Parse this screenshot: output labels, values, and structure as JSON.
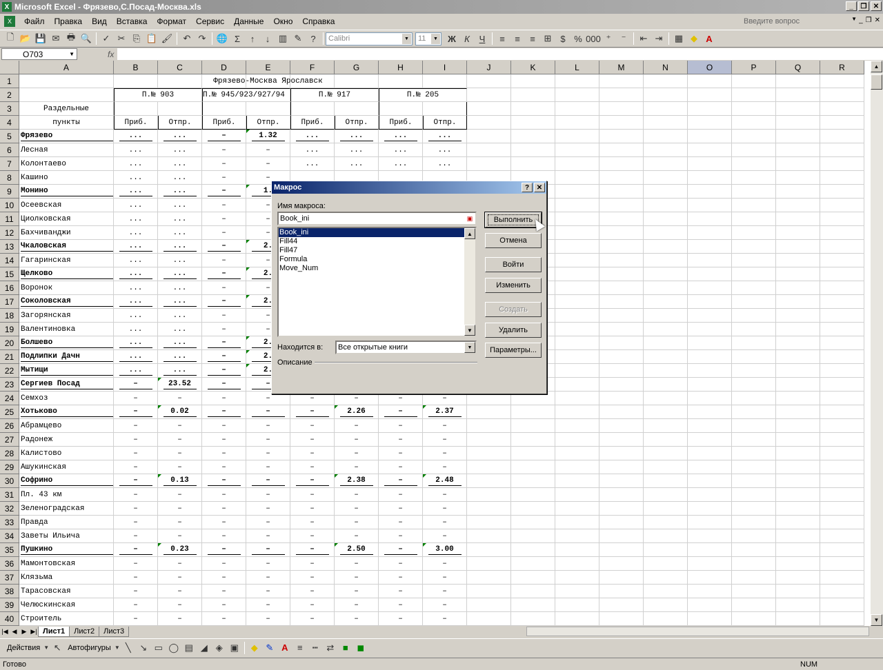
{
  "app": {
    "title": "Microsoft Excel - Фрязево,С.Посад-Москва.xls",
    "ask_placeholder": "Введите вопрос",
    "menu": [
      "Файл",
      "Правка",
      "Вид",
      "Вставка",
      "Формат",
      "Сервис",
      "Данные",
      "Окно",
      "Справка"
    ]
  },
  "toolbar": {
    "font": "Calibri",
    "size": "11"
  },
  "formula_bar": {
    "name_box": "O703",
    "fx": "fx",
    "value": ""
  },
  "columns": [
    {
      "label": "A"
    },
    {
      "label": "B"
    },
    {
      "label": "C"
    },
    {
      "label": "D"
    },
    {
      "label": "E"
    },
    {
      "label": "F"
    },
    {
      "label": "G"
    },
    {
      "label": "H"
    },
    {
      "label": "I"
    },
    {
      "label": "J"
    },
    {
      "label": "K"
    },
    {
      "label": "L"
    },
    {
      "label": "M"
    },
    {
      "label": "N"
    },
    {
      "label": "O",
      "selected": true
    },
    {
      "label": "P"
    },
    {
      "label": "Q"
    },
    {
      "label": "R"
    }
  ],
  "header": {
    "title": "Фрязево-Москва Ярославск",
    "trains": [
      "П.№ 903",
      "П.№ 945/923/927/94",
      "П.№ 917",
      "П.№ 205"
    ],
    "label_top": "Раздельные",
    "label_bottom": "пункты",
    "arr": "Приб.",
    "dep": "Отпр."
  },
  "rows": [
    {
      "n": 5,
      "name": "Фрязево",
      "bold": true,
      "v": [
        "...",
        "...",
        "–",
        "1.32",
        "...",
        "...",
        "...",
        "..."
      ]
    },
    {
      "n": 6,
      "name": "Лесная",
      "bold": false,
      "v": [
        "...",
        "...",
        "–",
        "–",
        "...",
        "...",
        "...",
        "..."
      ]
    },
    {
      "n": 7,
      "name": "Колонтаево",
      "bold": false,
      "v": [
        "...",
        "...",
        "–",
        "–",
        "...",
        "...",
        "...",
        "..."
      ]
    },
    {
      "n": 8,
      "name": "Кашино",
      "bold": false,
      "v": [
        "...",
        "...",
        "–",
        "–",
        "",
        "",
        "",
        ""
      ]
    },
    {
      "n": 9,
      "name": "Монино",
      "bold": true,
      "v": [
        "...",
        "...",
        "–",
        "1.",
        "",
        "",
        "",
        ""
      ]
    },
    {
      "n": 10,
      "name": "Осеевская",
      "bold": false,
      "v": [
        "...",
        "...",
        "–",
        "–",
        "",
        "",
        "",
        ""
      ]
    },
    {
      "n": 11,
      "name": "Циолковская",
      "bold": false,
      "v": [
        "...",
        "...",
        "–",
        "–",
        "",
        "",
        "",
        ""
      ]
    },
    {
      "n": 12,
      "name": "Бахчиванджи",
      "bold": false,
      "v": [
        "...",
        "...",
        "–",
        "–",
        "",
        "",
        "",
        ""
      ]
    },
    {
      "n": 13,
      "name": "Чкаловская",
      "bold": true,
      "v": [
        "...",
        "...",
        "–",
        "2.",
        "",
        "",
        "",
        ""
      ]
    },
    {
      "n": 14,
      "name": "Гагаринская",
      "bold": false,
      "v": [
        "...",
        "...",
        "–",
        "–",
        "",
        "",
        "",
        ""
      ]
    },
    {
      "n": 15,
      "name": "Щелково",
      "bold": true,
      "v": [
        "...",
        "...",
        "–",
        "2.",
        "",
        "",
        "",
        ""
      ]
    },
    {
      "n": 16,
      "name": "Воронок",
      "bold": false,
      "v": [
        "...",
        "...",
        "–",
        "–",
        "",
        "",
        "",
        ""
      ]
    },
    {
      "n": 17,
      "name": "Соколовская",
      "bold": true,
      "v": [
        "...",
        "...",
        "–",
        "2.",
        "",
        "",
        "",
        ""
      ]
    },
    {
      "n": 18,
      "name": "Загорянская",
      "bold": false,
      "v": [
        "...",
        "...",
        "–",
        "–",
        "",
        "",
        "",
        ""
      ]
    },
    {
      "n": 19,
      "name": "Валентиновка",
      "bold": false,
      "v": [
        "...",
        "...",
        "–",
        "–",
        "",
        "",
        "",
        ""
      ]
    },
    {
      "n": 20,
      "name": "Болшево",
      "bold": true,
      "v": [
        "...",
        "...",
        "–",
        "2.",
        "",
        "",
        "",
        ""
      ]
    },
    {
      "n": 21,
      "name": "Подлипки Дачн",
      "bold": true,
      "v": [
        "...",
        "...",
        "–",
        "2.",
        "",
        "",
        "",
        ""
      ]
    },
    {
      "n": 22,
      "name": "Мытищи",
      "bold": true,
      "v": [
        "...",
        "...",
        "–",
        "2.",
        "",
        "",
        "",
        ""
      ]
    },
    {
      "n": 23,
      "name": "Сергиев Посад",
      "bold": true,
      "v": [
        "–",
        "23.52",
        "–",
        "–",
        "",
        "",
        "",
        ""
      ]
    },
    {
      "n": 24,
      "name": "Семхоз",
      "bold": false,
      "v": [
        "–",
        "–",
        "–",
        "–",
        "–",
        "–",
        "–",
        "–"
      ]
    },
    {
      "n": 25,
      "name": "Хотьково",
      "bold": true,
      "v": [
        "–",
        "0.02",
        "–",
        "–",
        "–",
        "2.26",
        "–",
        "2.37"
      ]
    },
    {
      "n": 26,
      "name": "Абрамцево",
      "bold": false,
      "v": [
        "–",
        "–",
        "–",
        "–",
        "–",
        "–",
        "–",
        "–"
      ]
    },
    {
      "n": 27,
      "name": "Радонеж",
      "bold": false,
      "v": [
        "–",
        "–",
        "–",
        "–",
        "–",
        "–",
        "–",
        "–"
      ]
    },
    {
      "n": 28,
      "name": "Калистово",
      "bold": false,
      "v": [
        "–",
        "–",
        "–",
        "–",
        "–",
        "–",
        "–",
        "–"
      ]
    },
    {
      "n": 29,
      "name": "Ашукинская",
      "bold": false,
      "v": [
        "–",
        "–",
        "–",
        "–",
        "–",
        "–",
        "–",
        "–"
      ]
    },
    {
      "n": 30,
      "name": "Софрино",
      "bold": true,
      "v": [
        "–",
        "0.13",
        "–",
        "–",
        "–",
        "2.38",
        "–",
        "2.48"
      ]
    },
    {
      "n": 31,
      "name": "Пл. 43 км",
      "bold": false,
      "v": [
        "–",
        "–",
        "–",
        "–",
        "–",
        "–",
        "–",
        "–"
      ]
    },
    {
      "n": 32,
      "name": "Зеленоградская",
      "bold": false,
      "v": [
        "–",
        "–",
        "–",
        "–",
        "–",
        "–",
        "–",
        "–"
      ]
    },
    {
      "n": 33,
      "name": "Правда",
      "bold": false,
      "v": [
        "–",
        "–",
        "–",
        "–",
        "–",
        "–",
        "–",
        "–"
      ]
    },
    {
      "n": 34,
      "name": "Заветы Ильича",
      "bold": false,
      "v": [
        "–",
        "–",
        "–",
        "–",
        "–",
        "–",
        "–",
        "–"
      ]
    },
    {
      "n": 35,
      "name": "Пушкино",
      "bold": true,
      "v": [
        "–",
        "0.23",
        "–",
        "–",
        "–",
        "2.50",
        "–",
        "3.00"
      ]
    },
    {
      "n": 36,
      "name": "Мамонтовская",
      "bold": false,
      "v": [
        "–",
        "–",
        "–",
        "–",
        "–",
        "–",
        "–",
        "–"
      ]
    },
    {
      "n": 37,
      "name": "Клязьма",
      "bold": false,
      "v": [
        "–",
        "–",
        "–",
        "–",
        "–",
        "–",
        "–",
        "–"
      ]
    },
    {
      "n": 38,
      "name": "Тарасовская",
      "bold": false,
      "v": [
        "–",
        "–",
        "–",
        "–",
        "–",
        "–",
        "–",
        "–"
      ]
    },
    {
      "n": 39,
      "name": "Челюскинская",
      "bold": false,
      "v": [
        "–",
        "–",
        "–",
        "–",
        "–",
        "–",
        "–",
        "–"
      ]
    },
    {
      "n": 40,
      "name": "Строитель",
      "bold": false,
      "v": [
        "–",
        "–",
        "–",
        "–",
        "–",
        "–",
        "–",
        "–"
      ]
    }
  ],
  "sheets": [
    "Лист1",
    "Лист2",
    "Лист3"
  ],
  "drawing": {
    "actions": "Действия",
    "autoshapes": "Автофигуры"
  },
  "status": {
    "ready": "Готово",
    "num": "NUM"
  },
  "dialog": {
    "title": "Макрос",
    "name_label": "Имя макроса:",
    "name_value": "Book_ini",
    "macros": [
      "Book_ini",
      "Fill44",
      "Fill47",
      "Formula",
      "Move_Num"
    ],
    "selected": 0,
    "in_label": "Находится в:",
    "in_value": "Все открытые книги",
    "desc_label": "Описание",
    "buttons": {
      "run": "Выполнить",
      "cancel": "Отмена",
      "step": "Войти",
      "edit": "Изменить",
      "create": "Создать",
      "delete": "Удалить",
      "options": "Параметры..."
    }
  }
}
